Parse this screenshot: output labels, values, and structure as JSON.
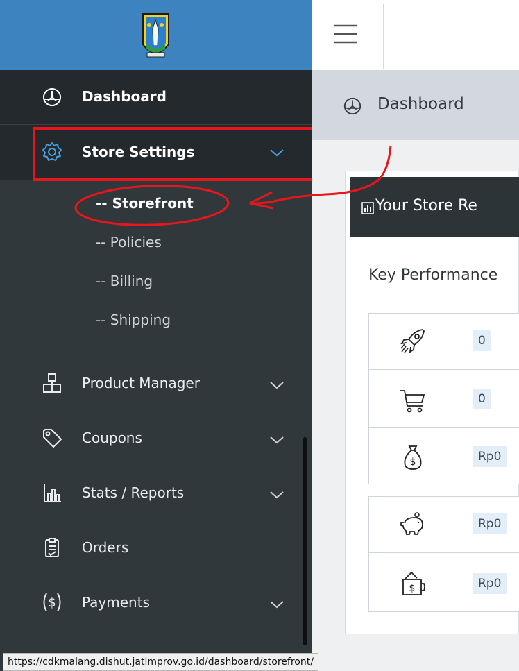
{
  "sidebar": {
    "items": [
      {
        "label": "Dashboard",
        "icon": "dashboard-gauge-icon"
      },
      {
        "label": "Store Settings",
        "icon": "gear-icon",
        "submenu": [
          "-- Storefront",
          "-- Policies",
          "-- Billing",
          "-- Shipping"
        ]
      },
      {
        "label": "Product Manager",
        "icon": "boxes-icon"
      },
      {
        "label": "Coupons",
        "icon": "tag-icon"
      },
      {
        "label": "Stats / Reports",
        "icon": "bar-chart-icon"
      },
      {
        "label": "Orders",
        "icon": "clipboard-icon"
      },
      {
        "label": "Payments",
        "icon": "dollar-circle-icon"
      }
    ]
  },
  "breadcrumb": {
    "label": "Dashboard"
  },
  "panel": {
    "title": "Your Store Re",
    "kpi_title": "Key Performance",
    "rows": [
      {
        "icon": "rocket-icon",
        "value": "0"
      },
      {
        "icon": "shopping-cart-icon",
        "value": "0"
      },
      {
        "icon": "money-bag-icon",
        "value": "Rp0"
      },
      {
        "icon": "piggy-bank-icon",
        "value": "Rp0"
      },
      {
        "icon": "wallet-icon",
        "value": "Rp0"
      }
    ]
  },
  "statusbar": {
    "url": "https://cdkmalang.dishut.jatimprov.go.id/dashboard/storefront/"
  },
  "colors": {
    "sidebar_bg": "#31383c",
    "logo_bar": "#3d83bf",
    "annotation_red": "#e8161b",
    "breadcrumb_bg": "#d2d8dd"
  }
}
